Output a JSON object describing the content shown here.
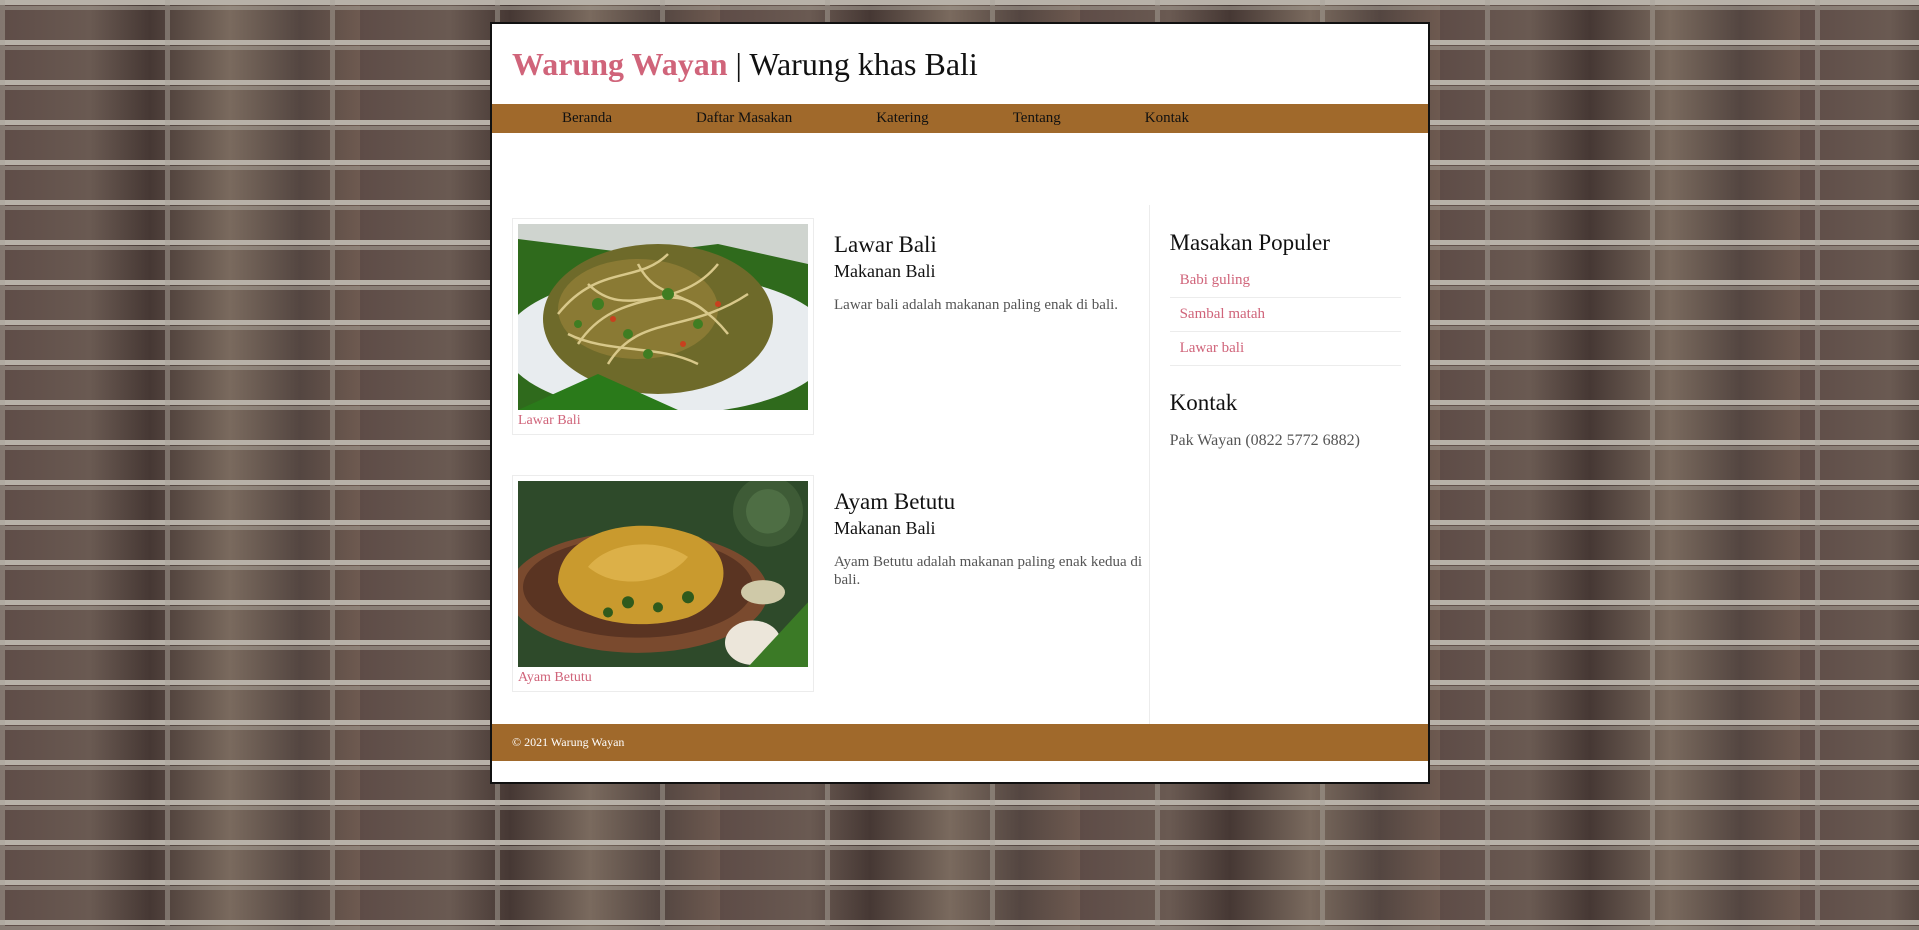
{
  "header": {
    "brand": "Warung Wayan",
    "separator": " | ",
    "tagline": "Warung khas Bali"
  },
  "nav": {
    "items": [
      "Beranda",
      "Daftar Masakan",
      "Katering",
      "Tentang",
      "Kontak"
    ]
  },
  "articles": [
    {
      "title": "Lawar Bali",
      "subtitle": "Makanan Bali",
      "description": "Lawar bali adalah makanan paling enak di bali.",
      "caption": "Lawar Bali"
    },
    {
      "title": "Ayam Betutu",
      "subtitle": "Makanan Bali",
      "description": "Ayam Betutu adalah makanan paling enak kedua di bali.",
      "caption": "Ayam Betutu"
    }
  ],
  "sidebar": {
    "popular_title": "Masakan Populer",
    "popular_items": [
      "Babi guling",
      "Sambal matah",
      "Lawar bali"
    ],
    "contact_title": "Kontak",
    "contact_text": "Pak Wayan (0822 5772 6882)"
  },
  "footer": {
    "copyright": "© 2021 Warung Wayan"
  },
  "colors": {
    "accent": "#d0647a",
    "nav_bg": "#a0692b"
  }
}
